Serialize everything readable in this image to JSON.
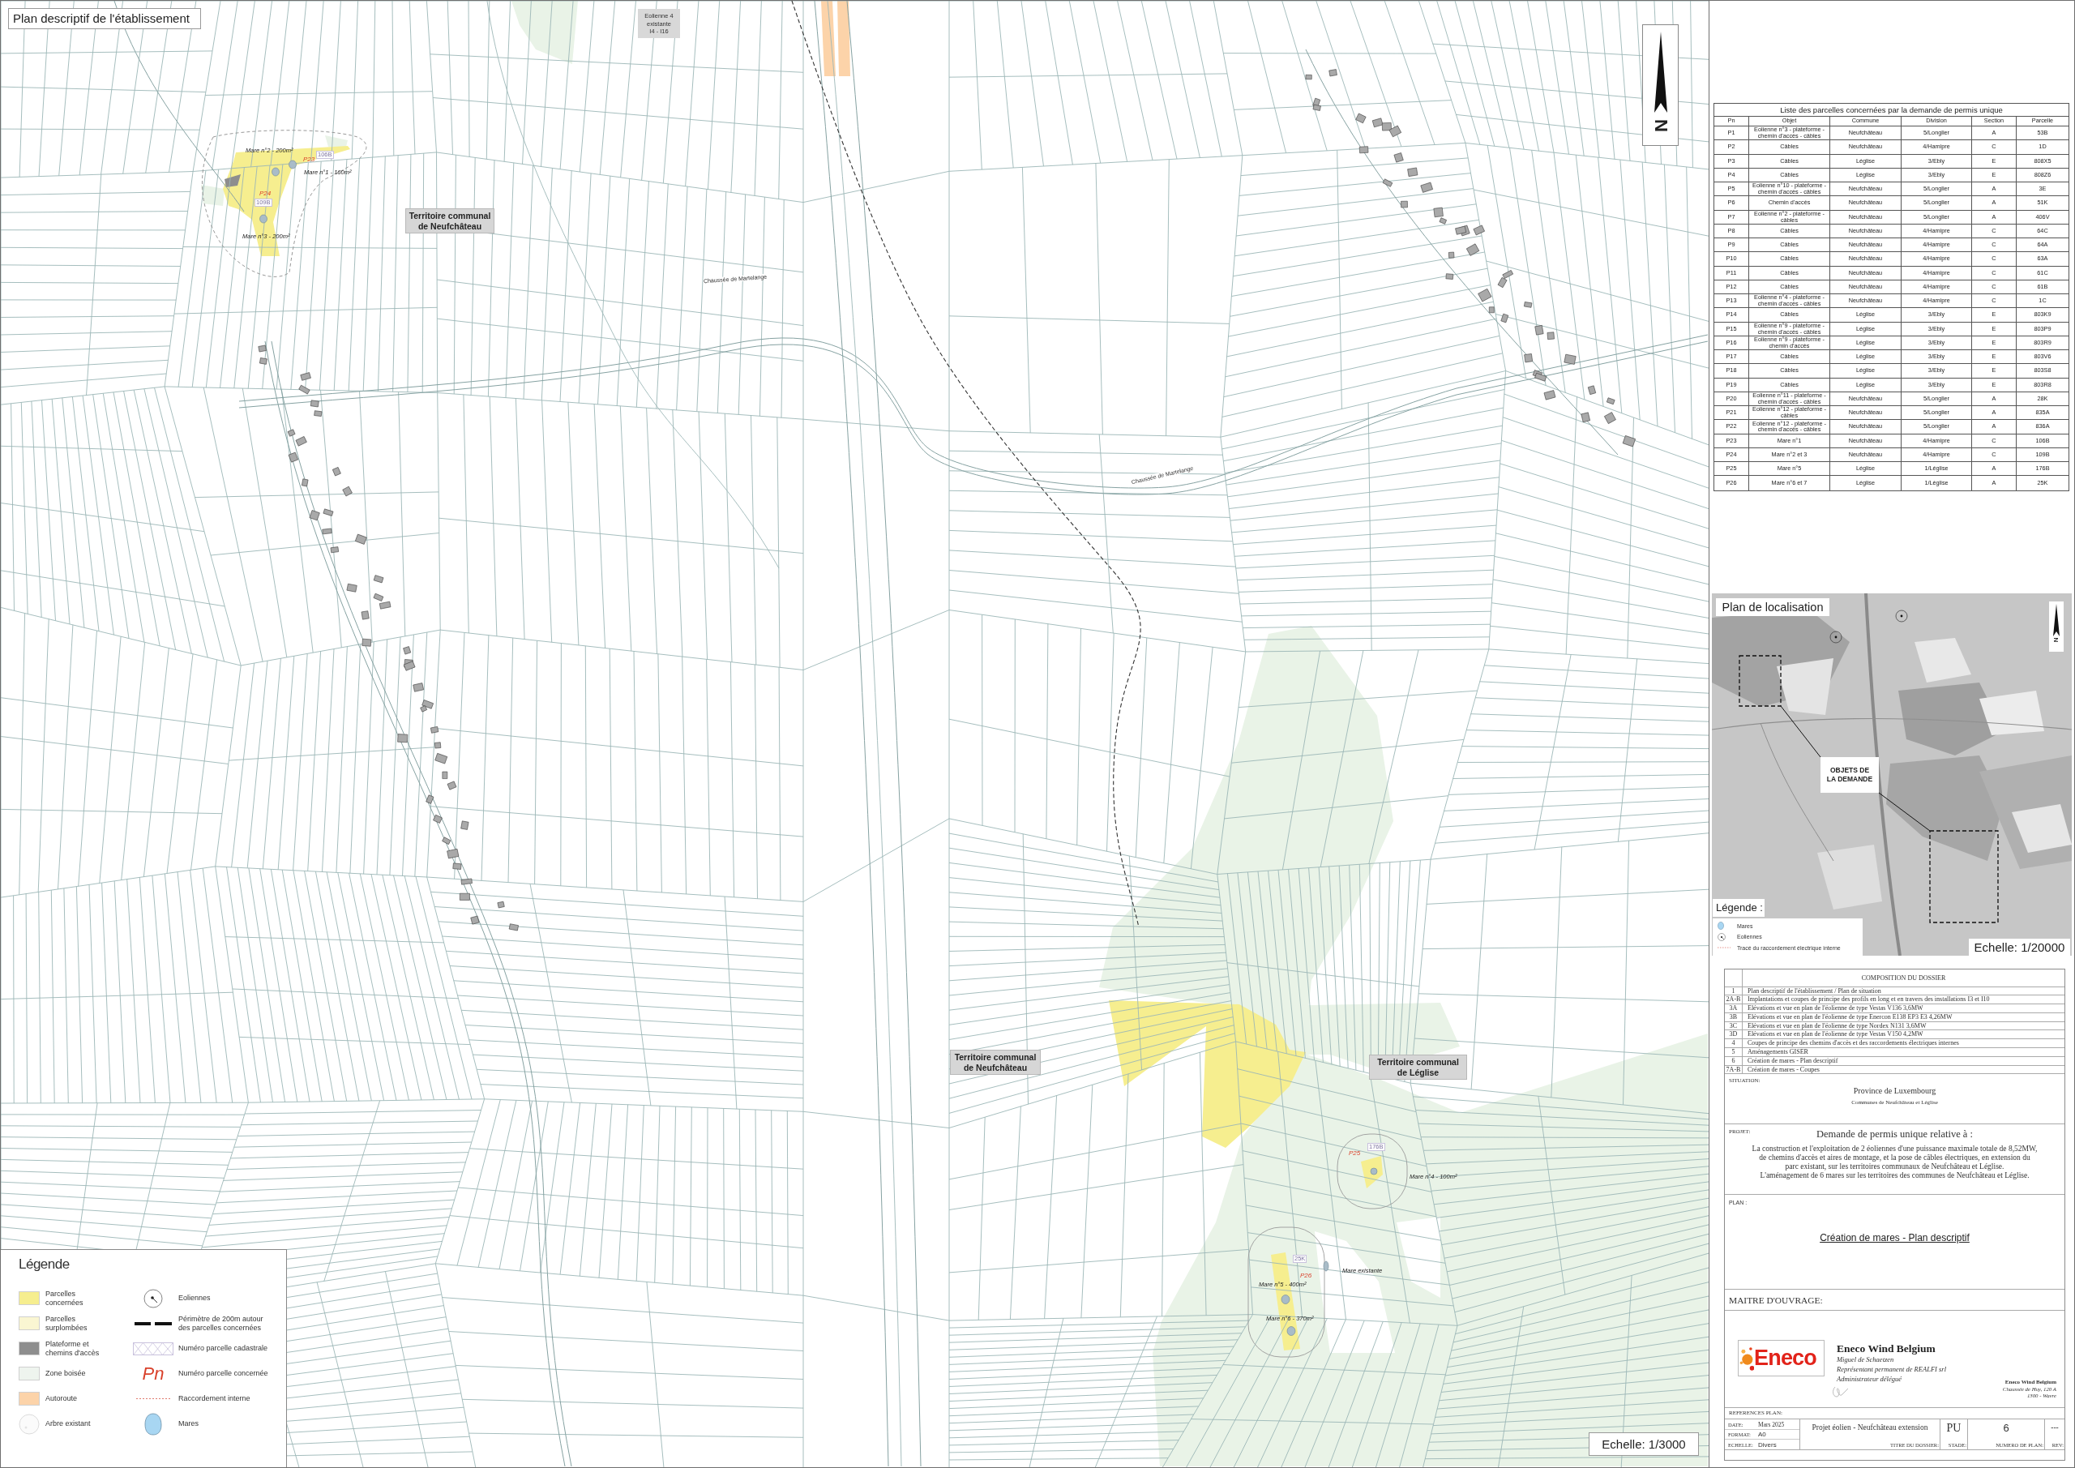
{
  "plan_map": {
    "title": "Plan descriptif de l'établissement",
    "existing_turbine": {
      "lines": [
        "Eolienne 4",
        "existante",
        "I4 - I16"
      ]
    },
    "north_label": "N",
    "territory_labels": [
      {
        "lines": [
          "Territoire communal",
          "de Neufchâteau"
        ]
      },
      {
        "lines": [
          "Territoire communal",
          "de Neufchâteau"
        ]
      },
      {
        "lines": [
          "Territoire communal",
          "de Léglise"
        ]
      }
    ],
    "road_labels": [
      "Chaussée de Martelange",
      "Chaussée de Martelange"
    ],
    "pond_labels": [
      "Mare n°2 - 200m²",
      "Mare n°1 - 160m²",
      "Mare n°3 - 200m²",
      "Mare n°4 - 100m²",
      "Mare existante",
      "Mare n°5 - 400m²",
      "Mare n°6 - 370m²"
    ],
    "parcel_labels": [
      {
        "number": "P23",
        "cadastral": "106B"
      },
      {
        "number": "P24",
        "cadastral": "109B"
      },
      {
        "number": "P25",
        "cadastral": "176B"
      },
      {
        "number": "P26",
        "cadastral": "25K"
      }
    ],
    "scale": "Echelle: 1/3000"
  },
  "legend": {
    "title": "Légende",
    "items": [
      {
        "kind": "swatch",
        "color": "#f6ee8f",
        "lines": [
          "Parcelles",
          "concernées"
        ]
      },
      {
        "kind": "swatch",
        "color": "#faf6d2",
        "lines": [
          "Parcelles",
          "surplombées"
        ]
      },
      {
        "kind": "swatch",
        "color": "#8e8e8e",
        "lines": [
          "Plateforme et",
          "chemins d'accès"
        ]
      },
      {
        "kind": "swatch",
        "color": "#eef4ee",
        "lines": [
          "Zone boisée"
        ]
      },
      {
        "kind": "swatch",
        "color": "#fcd3a9",
        "lines": [
          "Autoroute"
        ]
      },
      {
        "kind": "tree",
        "lines": [
          "Arbre existant"
        ]
      },
      {
        "kind": "turbine",
        "lines": [
          "Eoliennes"
        ]
      },
      {
        "kind": "dashed-line",
        "lines": [
          "Périmètre de 200m autour",
          "des parcelles concernées"
        ]
      },
      {
        "kind": "cadastral-number",
        "lines": [
          "Numéro parcelle cadastrale"
        ]
      },
      {
        "kind": "parcel-number",
        "symbol": "Pn",
        "lines": [
          "Numéro parcelle concernée"
        ]
      },
      {
        "kind": "connection-line",
        "lines": [
          "Raccordement interne"
        ]
      },
      {
        "kind": "pond",
        "lines": [
          "Mares"
        ]
      }
    ]
  },
  "parcel_table": {
    "title": "Liste des parcelles concernées par la demande de permis unique",
    "columns": [
      "Pn",
      "Objet",
      "Commune",
      "Division",
      "Section",
      "Parcelle"
    ],
    "rows": [
      [
        "P1",
        "Eolienne n°3 - plateforme - chemin d'accès - câbles",
        "Neufchâteau",
        "5/Longlier",
        "A",
        "53B"
      ],
      [
        "P2",
        "Câbles",
        "Neufchâteau",
        "4/Hamipre",
        "C",
        "1D"
      ],
      [
        "P3",
        "Câbles",
        "Léglise",
        "3/Ebly",
        "E",
        "808X5"
      ],
      [
        "P4",
        "Câbles",
        "Léglise",
        "3/Ebly",
        "E",
        "808Z6"
      ],
      [
        "P5",
        "Eolienne n°10 - plateforme - chemin d'accès - câbles",
        "Neufchâteau",
        "5/Longlier",
        "A",
        "3E"
      ],
      [
        "P6",
        "Chemin d'accès",
        "Neufchâteau",
        "5/Longlier",
        "A",
        "51K"
      ],
      [
        "P7",
        "Eolienne n°2 - plateforme - câbles",
        "Neufchâteau",
        "5/Longlier",
        "A",
        "406V"
      ],
      [
        "P8",
        "Câbles",
        "Neufchâteau",
        "4/Hamipre",
        "C",
        "64C"
      ],
      [
        "P9",
        "Câbles",
        "Neufchâteau",
        "4/Hamipre",
        "C",
        "64A"
      ],
      [
        "P10",
        "Câbles",
        "Neufchâteau",
        "4/Hamipre",
        "C",
        "63A"
      ],
      [
        "P11",
        "Câbles",
        "Neufchâteau",
        "4/Hamipre",
        "C",
        "61C"
      ],
      [
        "P12",
        "Câbles",
        "Neufchâteau",
        "4/Hamipre",
        "C",
        "61B"
      ],
      [
        "P13",
        "Eolienne n°4 - plateforme - chemin d'accès - câbles",
        "Neufchâteau",
        "4/Hamipre",
        "C",
        "1C"
      ],
      [
        "P14",
        "Câbles",
        "Léglise",
        "3/Ebly",
        "E",
        "803K9"
      ],
      [
        "P15",
        "Eolienne n°9 - plateforme - chemin d'accès - câbles",
        "Léglise",
        "3/Ebly",
        "E",
        "803P9"
      ],
      [
        "P16",
        "Eolienne n°9 - plateforme - chemin d'accès",
        "Léglise",
        "3/Ebly",
        "E",
        "803R9"
      ],
      [
        "P17",
        "Câbles",
        "Léglise",
        "3/Ebly",
        "E",
        "803V6"
      ],
      [
        "P18",
        "Câbles",
        "Léglise",
        "3/Ebly",
        "E",
        "803S8"
      ],
      [
        "P19",
        "Câbles",
        "Léglise",
        "3/Ebly",
        "E",
        "803R8"
      ],
      [
        "P20",
        "Eolienne n°11 - plateforme - chemin d'accès - câbles",
        "Neufchâteau",
        "5/Longlier",
        "A",
        "28K"
      ],
      [
        "P21",
        "Eolienne n°12 - plateforme - câbles",
        "Neufchâteau",
        "5/Longlier",
        "A",
        "835A"
      ],
      [
        "P22",
        "Eolienne n°12 - plateforme - chemin d'accès - câbles",
        "Neufchâteau",
        "5/Longlier",
        "A",
        "836A"
      ],
      [
        "P23",
        "Mare n°1",
        "Neufchâteau",
        "4/Hamipre",
        "C",
        "106B"
      ],
      [
        "P24",
        "Mare n°2 et 3",
        "Neufchâteau",
        "4/Hamipre",
        "C",
        "109B"
      ],
      [
        "P25",
        "Mare n°5",
        "Léglise",
        "1/Léglise",
        "A",
        "176B"
      ],
      [
        "P26",
        "Mare n°6 et 7",
        "Léglise",
        "1/Léglise",
        "A",
        "25K"
      ]
    ]
  },
  "location_plan": {
    "title": "Plan de localisation",
    "north_label": "N",
    "callout": {
      "lines": [
        "OBJETS DE",
        "LA DEMANDE"
      ]
    },
    "legend_title": "Légende :",
    "legend": [
      {
        "kind": "pond",
        "label": "Mares"
      },
      {
        "kind": "turbine",
        "label": "Eoliennes"
      },
      {
        "kind": "connection-line",
        "label": "Tracé du raccordement électrique interne"
      }
    ],
    "scale": "Echelle: 1/20000"
  },
  "title_block": {
    "composition": {
      "title": "COMPOSITION DU DOSSIER",
      "items": [
        {
          "number": "1",
          "label": "Plan descriptif de l'établissement / Plan de situation"
        },
        {
          "number": "2A-B",
          "label": "Implantations et coupes de principe des profils en long et en travers des installations I3 et I10"
        },
        {
          "number": "3A",
          "label": "Elévations et vue en plan de l'éolienne de type Vestas V136 3,6MW"
        },
        {
          "number": "3B",
          "label": "Elévations et vue en plan de l'éolienne de type Enercon E138 EP3 E3 4,26MW"
        },
        {
          "number": "3C",
          "label": "Elévations et vue en plan de l'éolienne de type Nordex N131 3,6MW"
        },
        {
          "number": "3D",
          "label": "Elévations et vue en plan de l'éolienne de type Vestas V150 4,2MW"
        },
        {
          "number": "4",
          "label": "Coupes de principe des chemins d'accès et des raccordements électriques internes"
        },
        {
          "number": "5",
          "label": "Aménagements GISER"
        },
        {
          "number": "6",
          "label": "Création de mares - Plan descriptif"
        },
        {
          "number": "7A-B",
          "label": "Création de mares - Coupes"
        }
      ]
    },
    "situation": {
      "heading": "SITUATION:",
      "province": "Province de Luxembourg",
      "communes": "Communes de Neufchâteau et Léglise"
    },
    "project": {
      "heading": "PROJET:",
      "title": "Demande de permis unique relative à :",
      "description_lines": [
        "La construction et l'exploitation de 2 éoliennes d'une puissance maximale totale de 8,52MW,",
        "de chemins d'accès et aires de montage, et la pose de câbles électriques, en extension du",
        "parc existant, sur les territoires communaux de Neufchâteau et Léglise.",
        "L'aménagement de 6 mares sur les territoires des communes de Neufchâteau et Léglise."
      ]
    },
    "plan": {
      "heading": "PLAN :",
      "title": "Création de mares - Plan descriptif"
    },
    "owner": {
      "heading": "MAITRE D'OUVRAGE:",
      "logo_text": "Eneco",
      "company": "Eneco Wind Belgium",
      "signatory": "Miguel de Schaetzen",
      "role_lines": [
        "Représentant permanent de REALFI srl",
        "Administrateur délégué"
      ],
      "stamp": {
        "company": "Eneco Wind Belgium",
        "address_lines": [
          "Chaussée de Huy, 120 A",
          "1300 - Wavre"
        ]
      }
    },
    "references": {
      "heading": "REFERENCES PLAN:",
      "date_label": "DATE:",
      "date": "Mars 2025",
      "format_label": "FORMAT:",
      "format": "A0",
      "scale_label": "ECHELLE:",
      "scale": "Divers",
      "dossier_title": "Projet éolien - Neufchâteau extension",
      "dossier_title_label": "TITRE DU DOSSIER:",
      "stage": "PU",
      "stage_label": "STADE:",
      "plan_number": "6",
      "plan_number_label": "NUMERO DE PLAN:",
      "revision": "---",
      "revision_label": "REV:"
    }
  }
}
